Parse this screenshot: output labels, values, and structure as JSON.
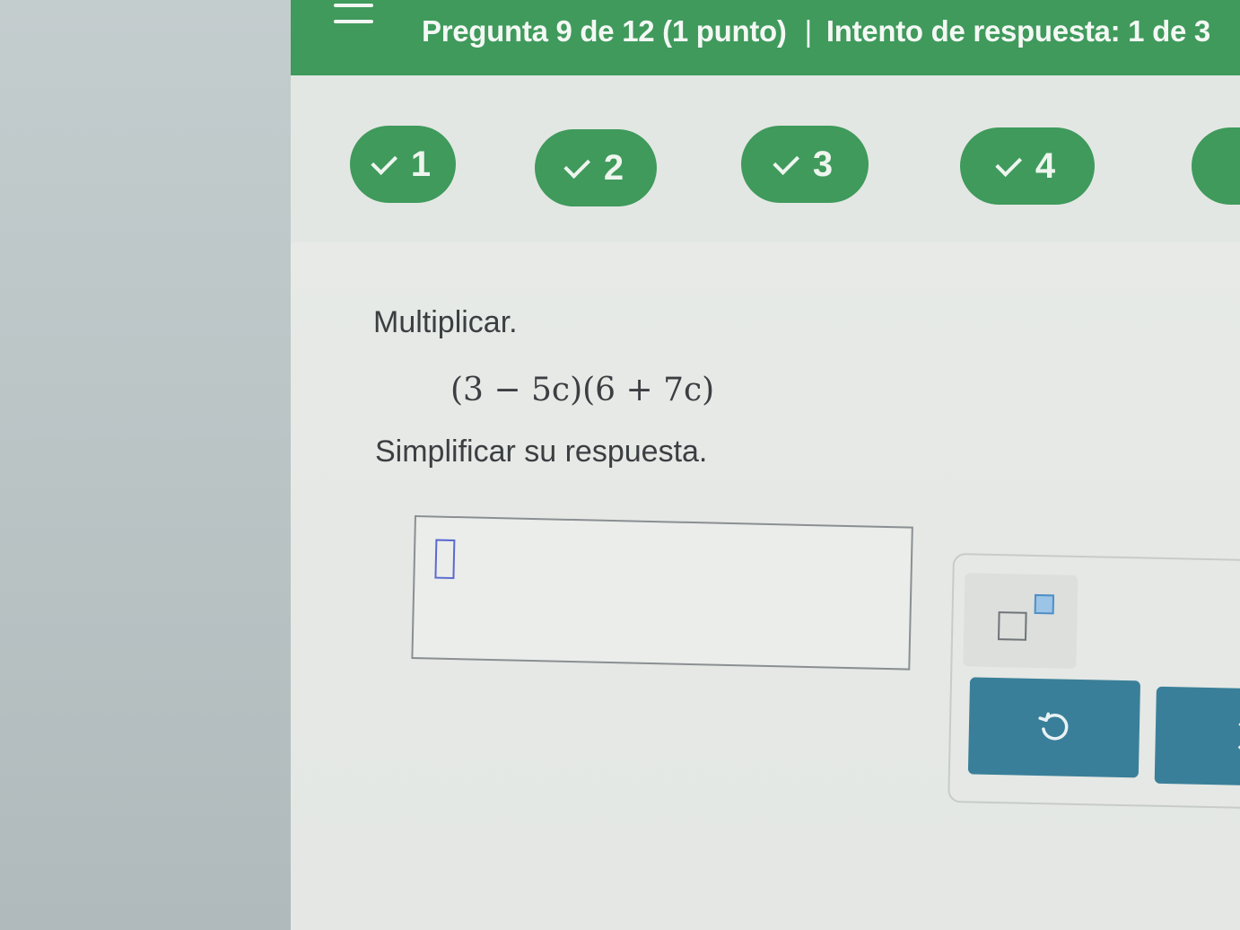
{
  "header": {
    "question_label": "Pregunta 9 de 12 (1 punto)",
    "separator": "|",
    "attempt_label": "Intento de respuesta: 1 de 3"
  },
  "question_nav": [
    {
      "number": "1",
      "status": "correct"
    },
    {
      "number": "2",
      "status": "correct"
    },
    {
      "number": "3",
      "status": "correct"
    },
    {
      "number": "4",
      "status": "correct"
    }
  ],
  "problem": {
    "prompt": "Multiplicar.",
    "expression": "(3 − 5c)(6 + 7c)",
    "instruction": "Simplificar su respuesta."
  },
  "answer": {
    "value": ""
  },
  "tools": {
    "exponent_icon": "superscript-template-icon",
    "undo_icon": "undo-icon",
    "next_icon": "chevron-right-icon"
  },
  "colors": {
    "header_green": "#3f9a5c",
    "button_teal": "#3a7f99",
    "cursor_blue": "#5a6ad0"
  }
}
